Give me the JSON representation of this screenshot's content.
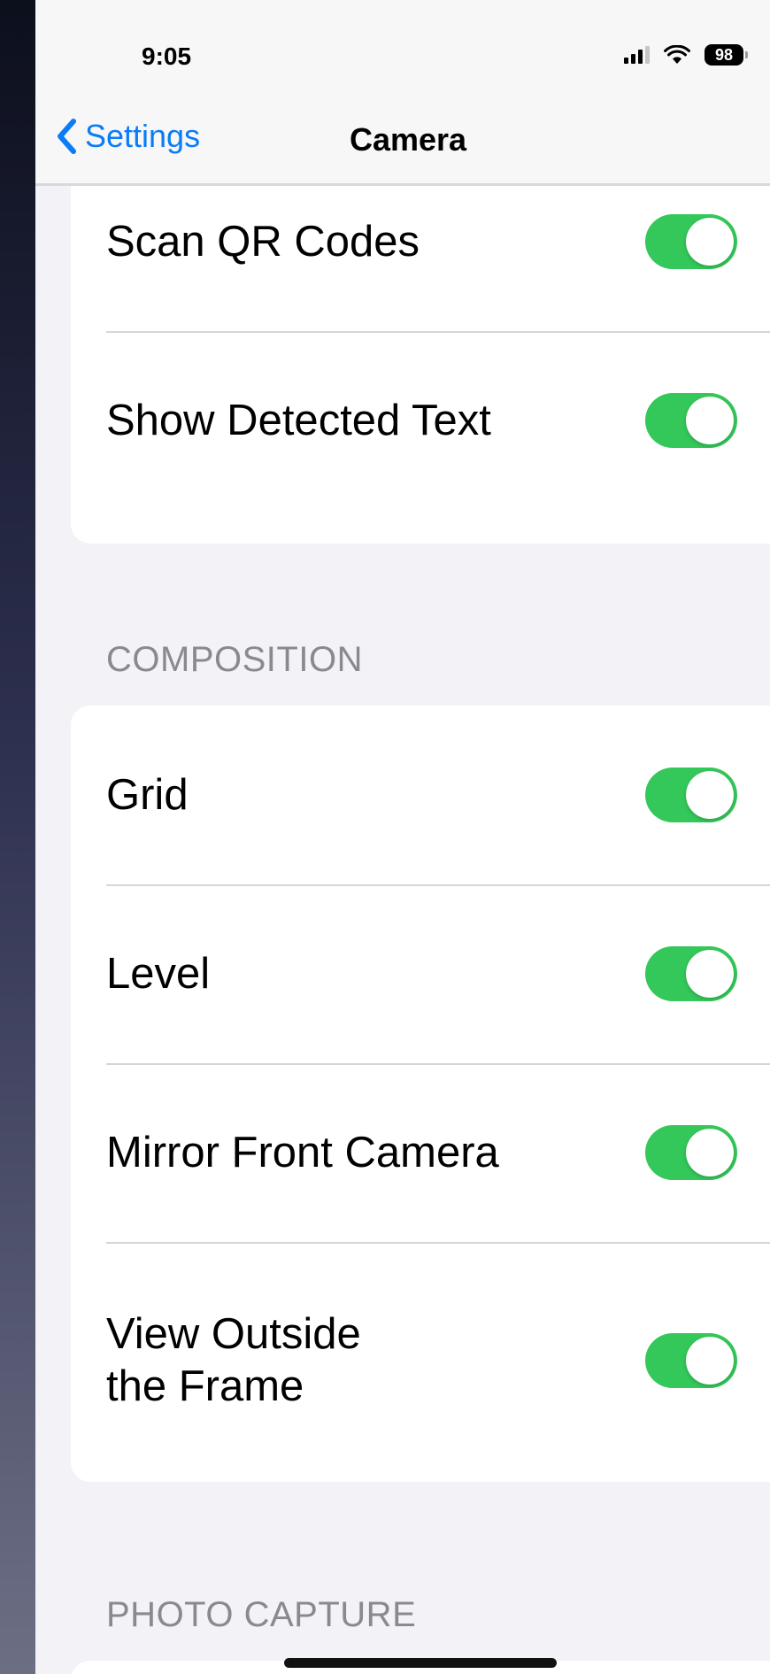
{
  "status_bar": {
    "time": "9:05",
    "battery": "98",
    "icons": [
      "signal-icon",
      "wifi-icon",
      "battery-icon"
    ]
  },
  "nav": {
    "back_label": "Settings",
    "title": "Camera"
  },
  "colors": {
    "accent": "#0a7cf6",
    "toggle_on": "#34c759"
  },
  "sections": [
    {
      "rows": [
        {
          "label": "Scan QR Codes",
          "enabled": true
        },
        {
          "label": "Show Detected Text",
          "enabled": true
        }
      ]
    },
    {
      "header": "COMPOSITION",
      "rows": [
        {
          "label": "Grid",
          "enabled": true
        },
        {
          "label": "Level",
          "enabled": true
        },
        {
          "label": "Mirror Front Camera",
          "enabled": true
        },
        {
          "label": "View Outside\nthe Frame",
          "enabled": true
        }
      ]
    },
    {
      "header": "PHOTO CAPTURE",
      "rows": []
    }
  ]
}
